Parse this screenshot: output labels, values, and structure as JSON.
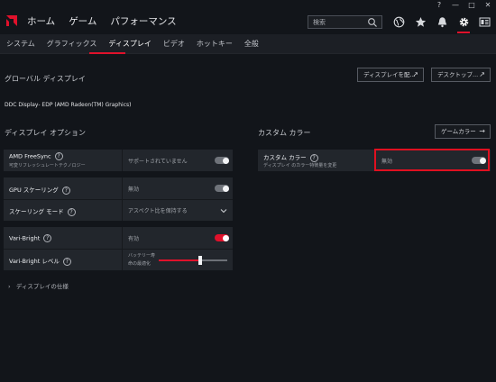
{
  "window_controls": {
    "help": "?",
    "minimize": "—",
    "maximize": "□",
    "close": "✕"
  },
  "topnav": {
    "items": [
      "ホーム",
      "ゲーム",
      "パフォーマンス"
    ]
  },
  "search": {
    "placeholder": "検索"
  },
  "subnav": {
    "items": [
      "システム",
      "グラフィックス",
      "ディスプレイ",
      "ビデオ",
      "ホットキー",
      "全般"
    ],
    "active_index": 2
  },
  "global_display": {
    "title": "グローバル ディスプレイ",
    "display_button": "ディスプレイを配...",
    "desktop_button": "デスクトップ...",
    "device_name": "DDC Display- EDP (AMD Radeon(TM) Graphics)"
  },
  "display_options": {
    "title": "ディスプレイ オプション",
    "freesync": {
      "label": "AMD FreeSync",
      "sublabel": "可変リフレッシュレートテクノロジー",
      "value": "サポートされていません",
      "toggle_state": "off"
    },
    "gpu_scaling": {
      "label": "GPU スケーリング",
      "value": "無効",
      "toggle_state": "off"
    },
    "scaling_mode": {
      "label": "スケーリング モード",
      "value": "アスペクト比を保持する"
    },
    "vari_bright": {
      "label": "Vari-Bright",
      "value": "有効",
      "toggle_state": "on"
    },
    "vari_bright_level": {
      "label": "Vari-Bright レベル",
      "value_line1": "バッテリー寿",
      "value_line2": "命の最適化",
      "slider_fraction": 0.6
    }
  },
  "custom_color": {
    "title": "カスタム カラー",
    "game_color_button": "ゲームカラー",
    "row": {
      "label": "カスタム カラー",
      "sublabel": "ディスプレイ のカラー特徴量を変更",
      "value": "無効",
      "toggle_state": "off"
    }
  },
  "display_spec": {
    "label": "ディスプレイの仕様"
  },
  "colors": {
    "accent": "#e0112b",
    "background": "#12151a",
    "panel": "#22262c"
  }
}
